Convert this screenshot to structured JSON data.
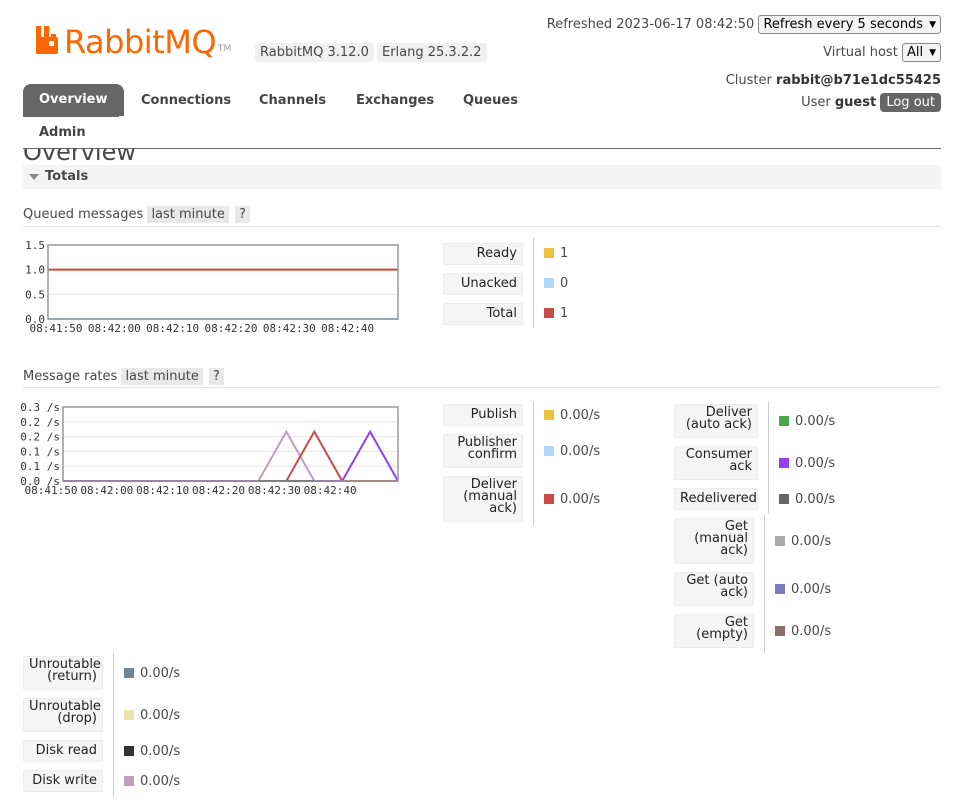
{
  "header": {
    "logo_text": "RabbitMQ",
    "logo_tm": "TM",
    "version": "RabbitMQ 3.12.0",
    "erlang": "Erlang 25.3.2.2",
    "refreshed_label": "Refreshed",
    "refreshed_time": "2023-06-17 08:42:50",
    "refresh_select": "Refresh every 5 seconds",
    "vhost_label": "Virtual host",
    "vhost_select": "All",
    "cluster_label": "Cluster",
    "cluster_name": "rabbit@b71e1dc55425",
    "user_label": "User",
    "user_name": "guest",
    "logout": "Log out"
  },
  "tabs": [
    "Overview",
    "Connections",
    "Channels",
    "Exchanges",
    "Queues",
    "Admin"
  ],
  "page": {
    "title": "Overview",
    "section": "Totals"
  },
  "queued": {
    "title": "Queued messages",
    "range": "last minute",
    "help": "?",
    "legend": [
      {
        "label": "Ready",
        "value": "1",
        "color": "#edc240"
      },
      {
        "label": "Unacked",
        "value": "0",
        "color": "#afd8f8"
      },
      {
        "label": "Total",
        "value": "1",
        "color": "#cb4b4b"
      }
    ]
  },
  "rates": {
    "title": "Message rates",
    "range": "last minute",
    "help": "?",
    "left": [
      {
        "label": "Publish",
        "value": "0.00/s",
        "color": "#edc240"
      },
      {
        "label": "Publisher confirm",
        "value": "0.00/s",
        "color": "#afd8f8"
      },
      {
        "label": "Deliver (manual ack)",
        "value": "0.00/s",
        "color": "#cb4b4b"
      }
    ],
    "right": [
      {
        "label": "Deliver (auto ack)",
        "value": "0.00/s",
        "color": "#4da74d"
      },
      {
        "label": "Consumer ack",
        "value": "0.00/s",
        "color": "#9440ed"
      },
      {
        "label": "Redelivered",
        "value": "0.00/s",
        "color": "#666666"
      },
      {
        "label": "Get (manual ack)",
        "value": "0.00/s",
        "color": "#aaaaaa"
      },
      {
        "label": "Get (auto ack)",
        "value": "0.00/s",
        "color": "#7c79c3"
      },
      {
        "label": "Get (empty)",
        "value": "0.00/s",
        "color": "#8d6c6c"
      }
    ],
    "bottom": [
      {
        "label": "Unroutable (return)",
        "value": "0.00/s",
        "color": "#718492"
      },
      {
        "label": "Unroutable (drop)",
        "value": "0.00/s",
        "color": "#e9e4ae"
      },
      {
        "label": "Disk read",
        "value": "0.00/s",
        "color": "#333333"
      },
      {
        "label": "Disk write",
        "value": "0.00/s",
        "color": "#bf9ebf"
      }
    ]
  },
  "chart_data": [
    {
      "type": "line",
      "title": "Queued messages",
      "x": [
        "08:41:50",
        "08:42:00",
        "08:42:10",
        "08:42:20",
        "08:42:30",
        "08:42:40"
      ],
      "ylim": [
        0,
        1.5
      ],
      "yticks": [
        "0.0",
        "0.5",
        "1.0",
        "1.5"
      ],
      "series": [
        {
          "name": "Ready",
          "color": "#edc240",
          "points": [
            [
              0,
              1
            ],
            [
              60,
              1
            ]
          ]
        },
        {
          "name": "Unacked",
          "color": "#afd8f8",
          "points": [
            [
              0,
              0
            ],
            [
              60,
              0
            ]
          ]
        },
        {
          "name": "Total",
          "color": "#cb4b4b",
          "points": [
            [
              0,
              1
            ],
            [
              60,
              1
            ]
          ]
        }
      ]
    },
    {
      "type": "line",
      "title": "Message rates",
      "x": [
        "08:41:50",
        "08:42:00",
        "08:42:10",
        "08:42:20",
        "08:42:30",
        "08:42:40"
      ],
      "ylim": [
        0,
        0.3
      ],
      "yticks": [
        "0.0 /s",
        "0.1 /s",
        "0.1 /s",
        "0.2 /s",
        "0.2 /s",
        "0.3 /s"
      ],
      "series": [
        {
          "name": "Publish",
          "color": "#edc240",
          "points": [
            [
              0,
              0
            ],
            [
              60,
              0
            ]
          ]
        },
        {
          "name": "Get (empty)",
          "color": "#bf9ebf",
          "points": [
            [
              0,
              0
            ],
            [
              35,
              0
            ],
            [
              40,
              0.2
            ],
            [
              45,
              0
            ],
            [
              60,
              0
            ]
          ]
        },
        {
          "name": "Deliver (manual ack)",
          "color": "#cb4b4b",
          "points": [
            [
              0,
              0
            ],
            [
              40,
              0
            ],
            [
              45,
              0.2
            ],
            [
              50,
              0
            ],
            [
              60,
              0
            ]
          ]
        },
        {
          "name": "Consumer ack",
          "color": "#9440ed",
          "points": [
            [
              0,
              0
            ],
            [
              50,
              0
            ],
            [
              55,
              0.2
            ],
            [
              60,
              0
            ]
          ]
        },
        {
          "name": "Disk read",
          "color": "#333333",
          "points": [
            [
              35,
              0
            ],
            [
              45,
              0
            ]
          ]
        }
      ]
    }
  ]
}
